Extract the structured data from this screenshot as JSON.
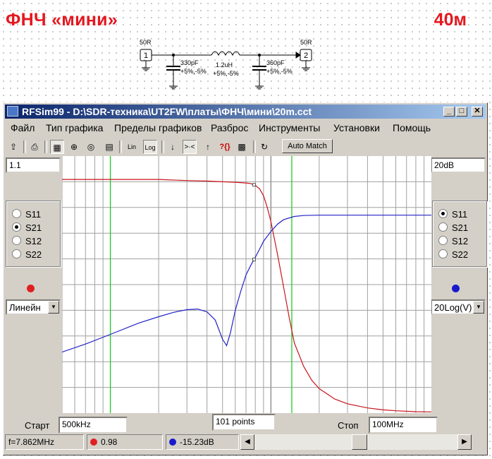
{
  "header": {
    "title": "ФНЧ «мини»",
    "band": "40м"
  },
  "schematic": {
    "port1": {
      "label": "50R",
      "number": "1"
    },
    "port2": {
      "label": "50R",
      "number": "2"
    },
    "c1": {
      "value": "330pF",
      "tol": "+5%,-5%"
    },
    "l1": {
      "value": "1.2uH",
      "tol": "+5%,-5%"
    },
    "c2": {
      "value": "360pF",
      "tol": "+5%,-5%"
    }
  },
  "window": {
    "title": "RFSim99 - D:\\SDR-техника\\UT2FW\\платы\\ФНЧ\\мини\\20m.cct",
    "controls": {
      "minimize": "_",
      "maximize": "□",
      "close": "✕"
    },
    "menu": [
      "Файл",
      "Тип графика",
      "Пределы графиков",
      "Разброс",
      "Инструменты",
      "Установки",
      "Помощь"
    ],
    "toolbar": {
      "icons": [
        "export-icon",
        "print-icon",
        "rect-plot-icon",
        "smith-chart-icon",
        "polar-plot-icon",
        "table-icon",
        "lin-scale-icon",
        "log-scale-icon",
        "arrow-down-icon",
        "narrow-icon",
        "arrow-up-icon",
        "help-icon",
        "component-icon",
        "reset-icon"
      ],
      "lin": "Lin",
      "log": "Log",
      "help": "?{}",
      "auto_match": "Auto Match"
    }
  },
  "left_panel": {
    "scale_value": "1.1",
    "params": [
      "S11",
      "S21",
      "S12",
      "S22"
    ],
    "selected": "S21",
    "marker_color": "#e02020",
    "mode": "Линейн"
  },
  "right_panel": {
    "scale_value": "20dB",
    "params": [
      "S11",
      "S21",
      "S12",
      "S22"
    ],
    "selected": "S11",
    "marker_color": "#1a1acc",
    "mode": "20Log(V)"
  },
  "sweep": {
    "start_label": "Старт",
    "start_value": "500kHz",
    "points": "101 points",
    "stop_label": "Стоп",
    "stop_value": "100MHz"
  },
  "status": {
    "frequency": "f=7.862MHz",
    "left_value": "0.98",
    "right_value": "-15.23dB"
  },
  "chart_data": {
    "type": "line",
    "x_scale": "log",
    "x_range_mhz": [
      0.5,
      100
    ],
    "grid": true,
    "markers_mhz": [
      1.0,
      13.5
    ],
    "cursor_mhz": 7.862,
    "series": [
      {
        "name": "S21",
        "color": "#c8141c",
        "axis": "left",
        "ylim": [
          0,
          1.1
        ],
        "x": [
          0.5,
          1,
          2,
          3,
          4,
          5,
          6,
          7,
          7.5,
          8,
          8.5,
          9,
          9.5,
          10,
          11,
          12,
          13,
          14,
          16,
          18,
          20,
          25,
          30,
          40,
          50,
          60,
          80,
          100
        ],
        "y": [
          1.0,
          1.0,
          1.0,
          0.995,
          0.993,
          0.99,
          0.988,
          0.985,
          0.982,
          0.975,
          0.96,
          0.93,
          0.88,
          0.82,
          0.68,
          0.54,
          0.41,
          0.3,
          0.2,
          0.14,
          0.105,
          0.06,
          0.04,
          0.022,
          0.014,
          0.01,
          0.006,
          0.005
        ]
      },
      {
        "name": "S11",
        "color": "#2323c8",
        "axis": "right",
        "ylim": [
          -60,
          20
        ],
        "x": [
          0.5,
          0.7,
          1,
          1.5,
          2,
          2.5,
          3,
          3.5,
          4,
          4.5,
          5,
          5.3,
          5.6,
          6,
          6.5,
          7,
          7.5,
          8,
          8.5,
          9,
          10,
          11,
          12,
          14,
          16,
          20,
          30,
          50,
          100
        ],
        "y": [
          -41,
          -38.5,
          -35.5,
          -32,
          -30,
          -28.6,
          -27.8,
          -27.6,
          -28.5,
          -31,
          -37,
          -39,
          -35,
          -28,
          -22,
          -17,
          -14,
          -11.5,
          -9,
          -6.5,
          -3.5,
          -1.2,
          0.2,
          1.2,
          1.5,
          1.6,
          1.6,
          1.6,
          1.6
        ]
      }
    ]
  }
}
